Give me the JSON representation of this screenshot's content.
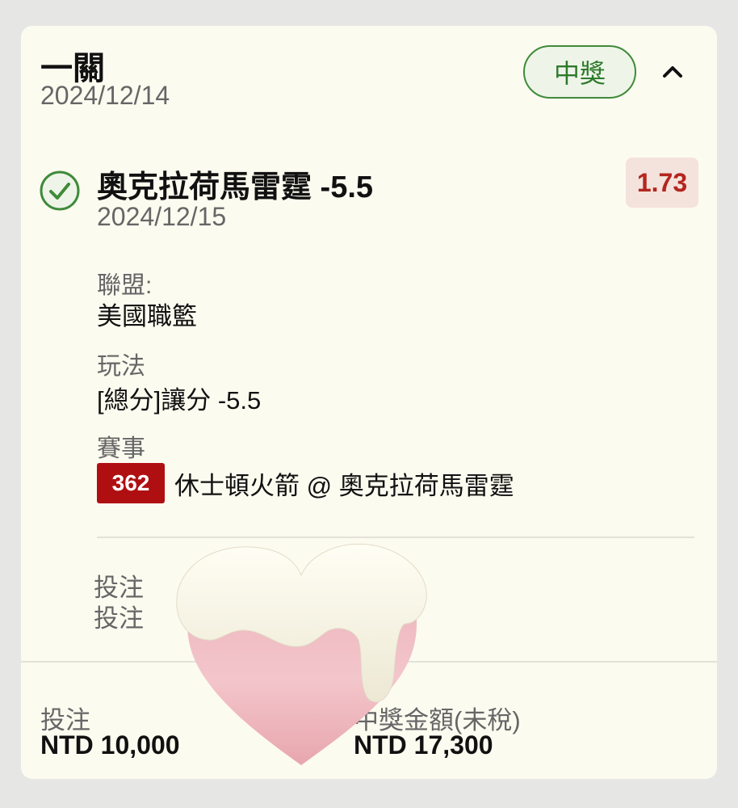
{
  "header": {
    "bet_type": "一關",
    "date": "2024/12/14",
    "status_badge": "中獎",
    "collapse_icon": "chevron-up-icon"
  },
  "selection": {
    "status_icon": "check-circle-icon",
    "name": "奧克拉荷馬雷霆 -5.5",
    "date": "2024/12/15",
    "odds": "1.73"
  },
  "details": {
    "league_label": "聯盟:",
    "league_value": "美國職籃",
    "market_label": "玩法",
    "market_value": "[總分]讓分 -5.5",
    "event_label": "賽事",
    "event_code": "362",
    "event_name": "休士頓火箭 @ 奧克拉荷馬雷霆",
    "bet_meta_1": "投注",
    "bet_meta_2": "投注"
  },
  "footer": {
    "stake_label": "投注",
    "stake_value": "NTD 10,000",
    "payout_label": "中獎金額(未稅)",
    "payout_value": "NTD 17,300"
  },
  "colors": {
    "card_bg": "#fcfbf0",
    "win_green": "#3f8a3a",
    "odds_red": "#b3261e",
    "event_red": "#b00f12"
  },
  "overlay": {
    "sticker_icon": "heart-sticker"
  }
}
